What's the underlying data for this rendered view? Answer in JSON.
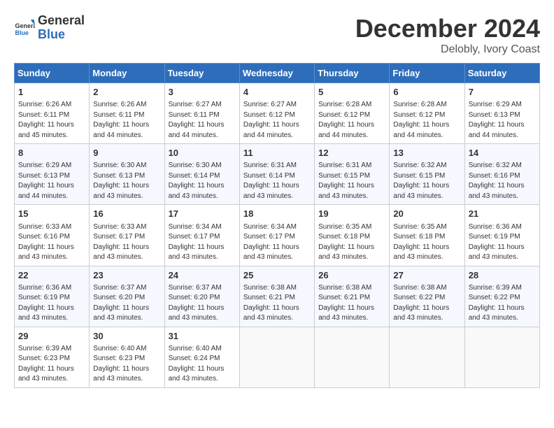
{
  "logo": {
    "line1": "General",
    "line2": "Blue"
  },
  "title": "December 2024",
  "location": "Delobly, Ivory Coast",
  "weekdays": [
    "Sunday",
    "Monday",
    "Tuesday",
    "Wednesday",
    "Thursday",
    "Friday",
    "Saturday"
  ],
  "weeks": [
    [
      {
        "day": "1",
        "info": "Sunrise: 6:26 AM\nSunset: 6:11 PM\nDaylight: 11 hours\nand 45 minutes."
      },
      {
        "day": "2",
        "info": "Sunrise: 6:26 AM\nSunset: 6:11 PM\nDaylight: 11 hours\nand 44 minutes."
      },
      {
        "day": "3",
        "info": "Sunrise: 6:27 AM\nSunset: 6:11 PM\nDaylight: 11 hours\nand 44 minutes."
      },
      {
        "day": "4",
        "info": "Sunrise: 6:27 AM\nSunset: 6:12 PM\nDaylight: 11 hours\nand 44 minutes."
      },
      {
        "day": "5",
        "info": "Sunrise: 6:28 AM\nSunset: 6:12 PM\nDaylight: 11 hours\nand 44 minutes."
      },
      {
        "day": "6",
        "info": "Sunrise: 6:28 AM\nSunset: 6:12 PM\nDaylight: 11 hours\nand 44 minutes."
      },
      {
        "day": "7",
        "info": "Sunrise: 6:29 AM\nSunset: 6:13 PM\nDaylight: 11 hours\nand 44 minutes."
      }
    ],
    [
      {
        "day": "8",
        "info": "Sunrise: 6:29 AM\nSunset: 6:13 PM\nDaylight: 11 hours\nand 44 minutes."
      },
      {
        "day": "9",
        "info": "Sunrise: 6:30 AM\nSunset: 6:13 PM\nDaylight: 11 hours\nand 43 minutes."
      },
      {
        "day": "10",
        "info": "Sunrise: 6:30 AM\nSunset: 6:14 PM\nDaylight: 11 hours\nand 43 minutes."
      },
      {
        "day": "11",
        "info": "Sunrise: 6:31 AM\nSunset: 6:14 PM\nDaylight: 11 hours\nand 43 minutes."
      },
      {
        "day": "12",
        "info": "Sunrise: 6:31 AM\nSunset: 6:15 PM\nDaylight: 11 hours\nand 43 minutes."
      },
      {
        "day": "13",
        "info": "Sunrise: 6:32 AM\nSunset: 6:15 PM\nDaylight: 11 hours\nand 43 minutes."
      },
      {
        "day": "14",
        "info": "Sunrise: 6:32 AM\nSunset: 6:16 PM\nDaylight: 11 hours\nand 43 minutes."
      }
    ],
    [
      {
        "day": "15",
        "info": "Sunrise: 6:33 AM\nSunset: 6:16 PM\nDaylight: 11 hours\nand 43 minutes."
      },
      {
        "day": "16",
        "info": "Sunrise: 6:33 AM\nSunset: 6:17 PM\nDaylight: 11 hours\nand 43 minutes."
      },
      {
        "day": "17",
        "info": "Sunrise: 6:34 AM\nSunset: 6:17 PM\nDaylight: 11 hours\nand 43 minutes."
      },
      {
        "day": "18",
        "info": "Sunrise: 6:34 AM\nSunset: 6:17 PM\nDaylight: 11 hours\nand 43 minutes."
      },
      {
        "day": "19",
        "info": "Sunrise: 6:35 AM\nSunset: 6:18 PM\nDaylight: 11 hours\nand 43 minutes."
      },
      {
        "day": "20",
        "info": "Sunrise: 6:35 AM\nSunset: 6:18 PM\nDaylight: 11 hours\nand 43 minutes."
      },
      {
        "day": "21",
        "info": "Sunrise: 6:36 AM\nSunset: 6:19 PM\nDaylight: 11 hours\nand 43 minutes."
      }
    ],
    [
      {
        "day": "22",
        "info": "Sunrise: 6:36 AM\nSunset: 6:19 PM\nDaylight: 11 hours\nand 43 minutes."
      },
      {
        "day": "23",
        "info": "Sunrise: 6:37 AM\nSunset: 6:20 PM\nDaylight: 11 hours\nand 43 minutes."
      },
      {
        "day": "24",
        "info": "Sunrise: 6:37 AM\nSunset: 6:20 PM\nDaylight: 11 hours\nand 43 minutes."
      },
      {
        "day": "25",
        "info": "Sunrise: 6:38 AM\nSunset: 6:21 PM\nDaylight: 11 hours\nand 43 minutes."
      },
      {
        "day": "26",
        "info": "Sunrise: 6:38 AM\nSunset: 6:21 PM\nDaylight: 11 hours\nand 43 minutes."
      },
      {
        "day": "27",
        "info": "Sunrise: 6:38 AM\nSunset: 6:22 PM\nDaylight: 11 hours\nand 43 minutes."
      },
      {
        "day": "28",
        "info": "Sunrise: 6:39 AM\nSunset: 6:22 PM\nDaylight: 11 hours\nand 43 minutes."
      }
    ],
    [
      {
        "day": "29",
        "info": "Sunrise: 6:39 AM\nSunset: 6:23 PM\nDaylight: 11 hours\nand 43 minutes."
      },
      {
        "day": "30",
        "info": "Sunrise: 6:40 AM\nSunset: 6:23 PM\nDaylight: 11 hours\nand 43 minutes."
      },
      {
        "day": "31",
        "info": "Sunrise: 6:40 AM\nSunset: 6:24 PM\nDaylight: 11 hours\nand 43 minutes."
      },
      null,
      null,
      null,
      null
    ]
  ]
}
